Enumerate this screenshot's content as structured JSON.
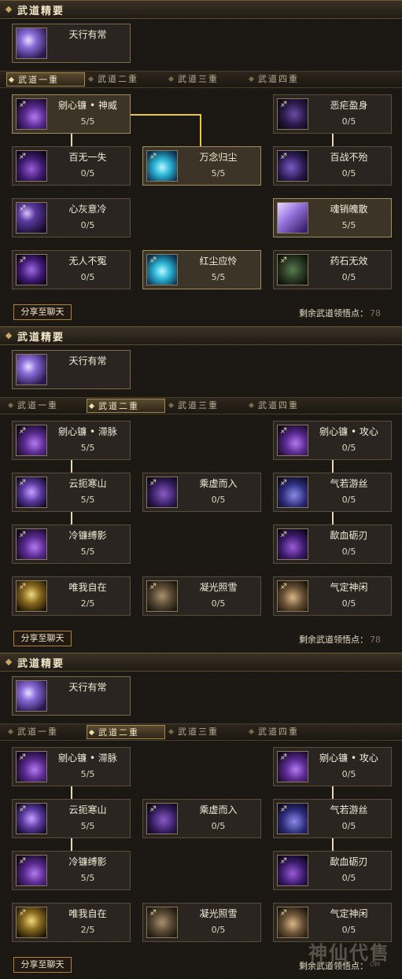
{
  "panels": [
    {
      "header": "武道精要",
      "essence": {
        "name": "天行有常",
        "icon": "purple-spirit-icon"
      },
      "tabs": [
        "武道一重",
        "武道二重",
        "武道三重",
        "武道四重"
      ],
      "active_tab": 0,
      "skills": [
        {
          "name": "剜心镰 • 神威",
          "level": "5/5",
          "icon": "purple-scythe-icon",
          "learned": true
        },
        {
          "name": "恶疟盈身",
          "level": "0/5",
          "icon": "dark-purple-beast-icon",
          "learned": false
        },
        {
          "name": "百无一失",
          "level": "0/5",
          "icon": "purple-blade-icon",
          "learned": false
        },
        {
          "name": "万念归尘",
          "level": "5/5",
          "icon": "cyan-ghost-icon",
          "learned": true
        },
        {
          "name": "百战不殆",
          "level": "0/5",
          "icon": "purple-knight-icon",
          "learned": false
        },
        {
          "name": "心灰意冷",
          "level": "0/5",
          "icon": "purple-moon-icon",
          "learned": false
        },
        {
          "name": "魂销魄散",
          "level": "5/5",
          "icon": "violet-crystal-icon",
          "learned": true
        },
        {
          "name": "无人不冤",
          "level": "0/5",
          "icon": "purple-strike-icon",
          "learned": false
        },
        {
          "name": "红尘应怜",
          "level": "5/5",
          "icon": "cyan-ghost-icon",
          "learned": true
        },
        {
          "name": "药石无效",
          "level": "0/5",
          "icon": "green-shade-icon",
          "learned": false
        }
      ],
      "share_label": "分享至聊天",
      "remaining_label": "剩余武道领悟点：",
      "remaining_value": "78"
    },
    {
      "header": "武道精要",
      "essence": {
        "name": "天行有常",
        "icon": "purple-spirit-icon"
      },
      "tabs": [
        "武道一重",
        "武道二重",
        "武道三重",
        "武道四重"
      ],
      "active_tab": 1,
      "skills": [
        {
          "name": "剜心镰 • 滞脉",
          "level": "5/5",
          "icon": "purple-scythe-icon",
          "learned": false
        },
        {
          "name": "剜心镰 • 攻心",
          "level": "0/5",
          "icon": "purple-scythe-icon",
          "learned": false
        },
        {
          "name": "云扼寒山",
          "level": "5/5",
          "icon": "purple-figure-icon",
          "learned": false
        },
        {
          "name": "乘虚而入",
          "level": "0/5",
          "icon": "purple-shadow-icon",
          "learned": false
        },
        {
          "name": "气若游丝",
          "level": "0/5",
          "icon": "purple-mist-icon",
          "learned": false
        },
        {
          "name": "冷镰缚影",
          "level": "5/5",
          "icon": "purple-scythe-icon",
          "learned": false
        },
        {
          "name": "歃血砺刃",
          "level": "0/5",
          "icon": "purple-blade-icon",
          "learned": false
        },
        {
          "name": "唯我自在",
          "level": "2/5",
          "icon": "golden-warrior-icon",
          "learned": false
        },
        {
          "name": "凝光照雪",
          "level": "0/5",
          "icon": "brown-scroll-icon",
          "learned": false
        },
        {
          "name": "气定神闲",
          "level": "0/5",
          "icon": "brown-orb-icon",
          "learned": false
        }
      ],
      "share_label": "分享至聊天",
      "remaining_label": "剩余武道领悟点：",
      "remaining_value": "78"
    },
    {
      "header": "武道精要",
      "essence": {
        "name": "天行有常",
        "icon": "purple-spirit-icon"
      },
      "tabs": [
        "武道一重",
        "武道二重",
        "武道三重",
        "武道四重"
      ],
      "active_tab": 1,
      "skills": [
        {
          "name": "剜心镰 • 滞脉",
          "level": "5/5",
          "icon": "purple-scythe-icon",
          "learned": false
        },
        {
          "name": "剜心镰 • 攻心",
          "level": "0/5",
          "icon": "purple-scythe-icon",
          "learned": false
        },
        {
          "name": "云扼寒山",
          "level": "5/5",
          "icon": "purple-figure-icon",
          "learned": false
        },
        {
          "name": "乘虚而入",
          "level": "0/5",
          "icon": "purple-shadow-icon",
          "learned": false
        },
        {
          "name": "气若游丝",
          "level": "0/5",
          "icon": "purple-mist-icon",
          "learned": false
        },
        {
          "name": "冷镰缚影",
          "level": "5/5",
          "icon": "purple-scythe-icon",
          "learned": false
        },
        {
          "name": "歃血砺刃",
          "level": "0/5",
          "icon": "purple-blade-icon",
          "learned": false
        },
        {
          "name": "唯我自在",
          "level": "2/5",
          "icon": "golden-warrior-icon",
          "learned": false
        },
        {
          "name": "凝光照雪",
          "level": "0/5",
          "icon": "brown-scroll-icon",
          "learned": false
        },
        {
          "name": "气定神闲",
          "level": "0/5",
          "icon": "brown-orb-icon",
          "learned": false
        }
      ],
      "share_label": "分享至聊天",
      "remaining_label": "剩余武道领悟点：",
      "remaining_value": ""
    }
  ],
  "watermark": "神仙代售",
  "watermark_sub": "OM",
  "colors": {
    "gold_border": "#a08e62",
    "link_gold": "#e8c840",
    "link_white": "#e8d8b0"
  }
}
